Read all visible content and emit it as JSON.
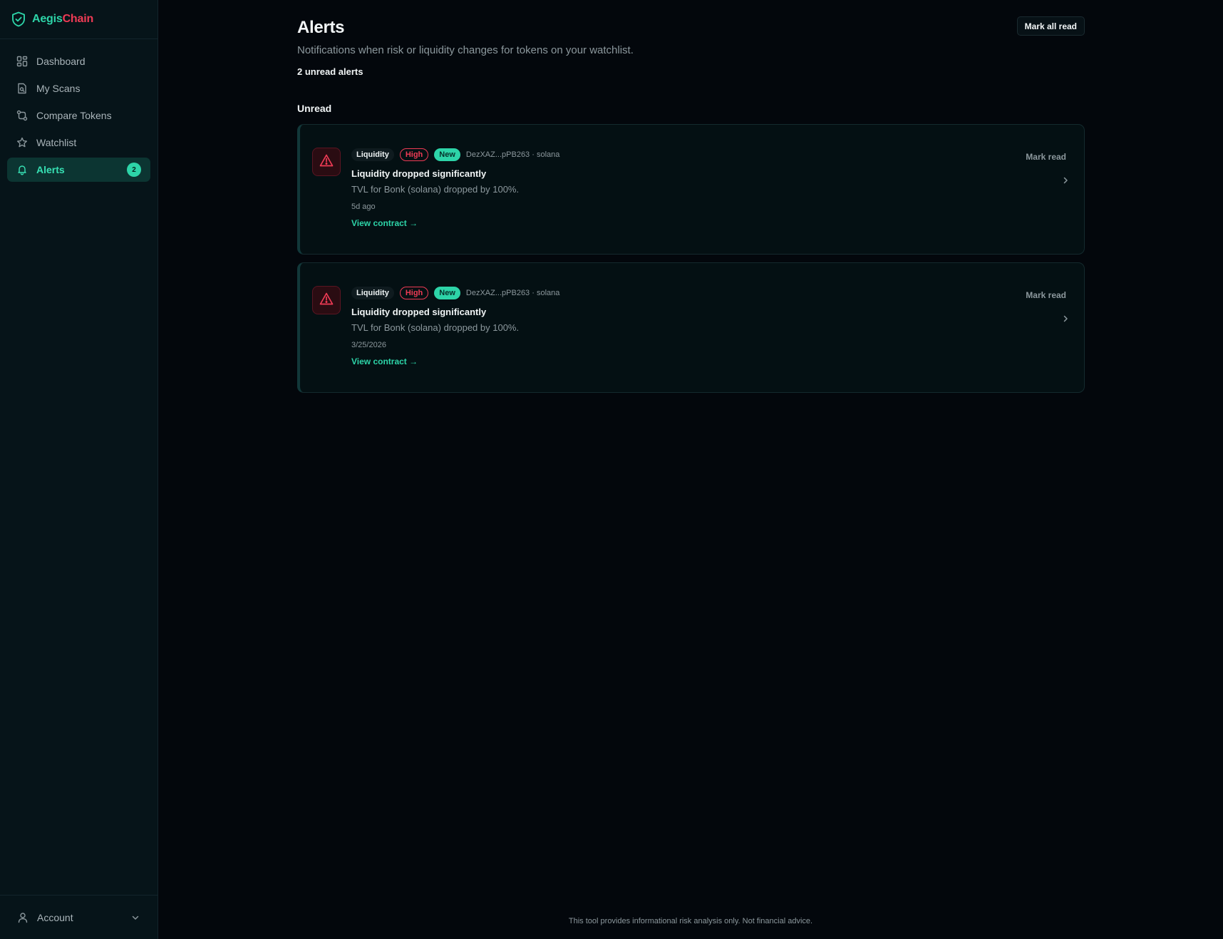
{
  "brand": {
    "name_part1": "Aegis",
    "name_part2": "Chain",
    "icon": "shield-check-icon"
  },
  "sidebar": {
    "items": [
      {
        "label": "Dashboard",
        "icon": "grid-icon",
        "active": false
      },
      {
        "label": "My Scans",
        "icon": "file-search-icon",
        "active": false
      },
      {
        "label": "Compare Tokens",
        "icon": "compare-icon",
        "active": false
      },
      {
        "label": "Watchlist",
        "icon": "star-icon",
        "active": false
      },
      {
        "label": "Alerts",
        "icon": "bell-icon",
        "active": true,
        "badge": "2"
      }
    ],
    "account_label": "Account"
  },
  "header": {
    "title": "Alerts",
    "subtitle": "Notifications when risk or liquidity changes for tokens on your watchlist.",
    "unread_count_text": "2 unread alerts",
    "mark_all_label": "Mark all read"
  },
  "section_label": "Unread",
  "alerts": [
    {
      "category": "Liquidity",
      "severity": "High",
      "status": "New",
      "meta": "DezXAZ...pPB263 · solana",
      "title": "Liquidity dropped significantly",
      "description": "TVL for Bonk (solana) dropped by 100%.",
      "time": "5d ago",
      "link_label": "View contract →",
      "mark_read_label": "Mark read"
    },
    {
      "category": "Liquidity",
      "severity": "High",
      "status": "New",
      "meta": "DezXAZ...pPB263 · solana",
      "title": "Liquidity dropped significantly",
      "description": "TVL for Bonk (solana) dropped by 100%.",
      "time": "3/25/2026",
      "link_label": "View contract →",
      "mark_read_label": "Mark read"
    }
  ],
  "footer_note": "This tool provides informational risk analysis only. Not financial advice.",
  "colors": {
    "accent": "#2dd4a8",
    "danger": "#ef3b55",
    "background": "#03070c",
    "sidebar": "#061419"
  }
}
